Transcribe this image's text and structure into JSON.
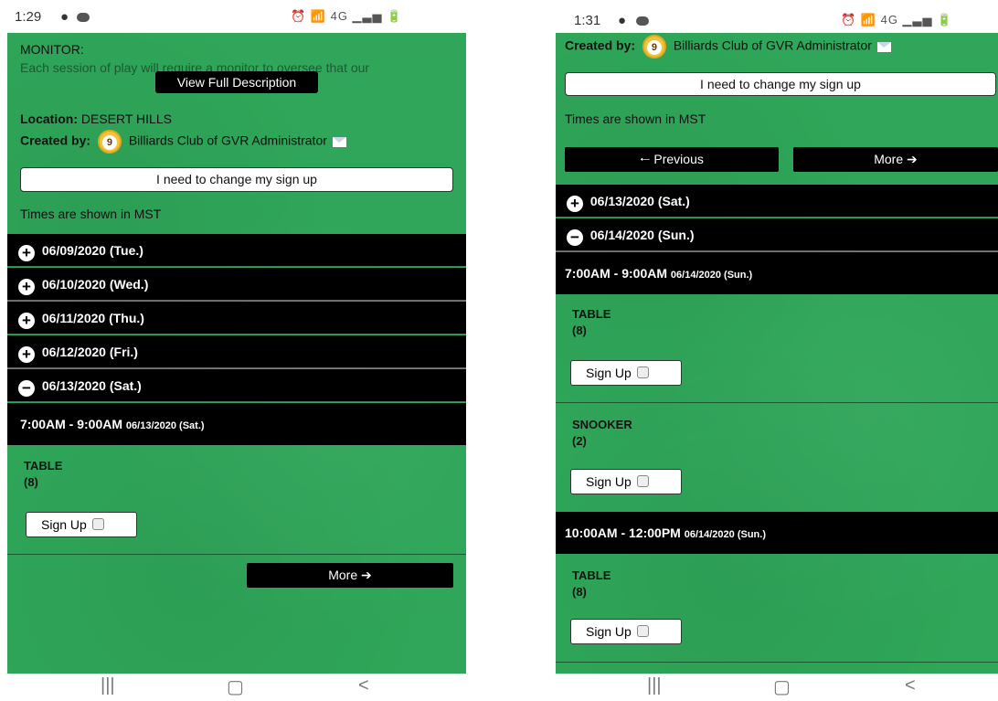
{
  "left": {
    "status": {
      "time": "1:29",
      "icons": "⏰ 📶 4G ▁▃▅ 🔋"
    },
    "monitor_heading": "MONITOR:",
    "monitor_text": "Each session of play will require a monitor to oversee that our",
    "view_full_label": "View Full Description",
    "location_label": "Location:",
    "location_value": "DESERT HILLS",
    "created_by_label": "Created by:",
    "ball_number": "9",
    "creator_name": "Billiards Club of GVR Administrator",
    "change_signup_label": "I need to change my sign up",
    "times_note": "Times are shown in MST",
    "days": [
      {
        "icon": "+",
        "label": "06/09/2020 (Tue.)"
      },
      {
        "icon": "+",
        "label": "06/10/2020 (Wed.)"
      },
      {
        "icon": "+",
        "label": "06/11/2020 (Thu.)"
      },
      {
        "icon": "+",
        "label": "06/12/2020 (Fri.)"
      },
      {
        "icon": "−",
        "label": "06/13/2020 (Sat.)"
      }
    ],
    "slot": {
      "time": "7:00AM - 9:00AM",
      "date": "06/13/2020 (Sat.)"
    },
    "item": {
      "name": "TABLE",
      "count": "(8)",
      "signup_label": "Sign Up"
    },
    "more_label": "More"
  },
  "right": {
    "status": {
      "time": "1:31",
      "icons": "⏰ 📶 4G ▁▃▅ 🔋"
    },
    "created_by_label": "Created by:",
    "ball_number": "9",
    "creator_name": "Billiards Club of GVR Administrator",
    "change_signup_label": "I need to change my sign up",
    "times_note": "Times are shown in MST",
    "previous_label": "Previous",
    "more_label": "More",
    "days": [
      {
        "icon": "+",
        "label": "06/13/2020 (Sat.)"
      },
      {
        "icon": "−",
        "label": "06/14/2020 (Sun.)"
      }
    ],
    "slot1": {
      "time": "7:00AM - 9:00AM",
      "date": "06/14/2020 (Sun.)"
    },
    "slot1_items": [
      {
        "name": "TABLE",
        "count": "(8)",
        "signup_label": "Sign Up"
      },
      {
        "name": "SNOOKER",
        "count": "(2)",
        "signup_label": "Sign Up"
      }
    ],
    "slot2": {
      "time": "10:00AM - 12:00PM",
      "date": "06/14/2020 (Sun.)"
    },
    "slot2_items": [
      {
        "name": "TABLE",
        "count": "(8)",
        "signup_label": "Sign Up"
      }
    ]
  },
  "navbar": {
    "recents": "|||",
    "home": "▢",
    "back": "<"
  }
}
